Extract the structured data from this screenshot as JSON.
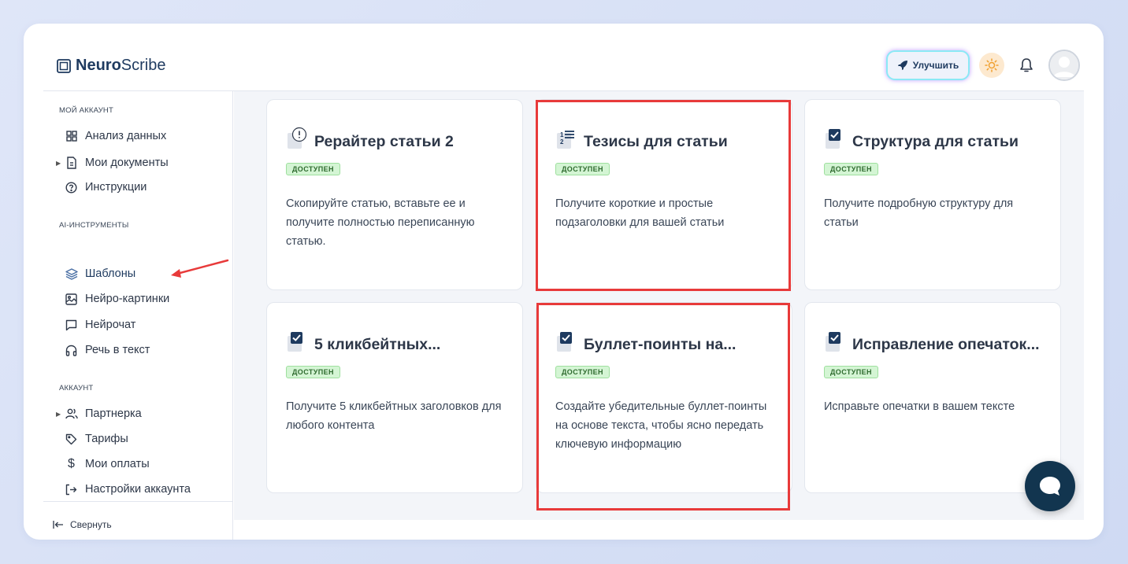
{
  "app": {
    "logo_bold": "Neuro",
    "logo_rest": "Scribe"
  },
  "header": {
    "upgrade_label": "Улучшить"
  },
  "sidebar": {
    "sections": [
      {
        "title": "МОЙ АККАУНТ",
        "items": [
          {
            "label": "Анализ данных",
            "icon": "grid-icon"
          },
          {
            "label": "Мои документы",
            "icon": "document-icon",
            "expandable": true
          },
          {
            "label": "Инструкции",
            "icon": "help-circle-icon"
          }
        ]
      },
      {
        "title": "AI-ИНСТРУМЕНТЫ",
        "items": [
          {
            "label": "Шаблоны",
            "icon": "layers-icon",
            "active": true
          },
          {
            "label": "Нейро-картинки",
            "icon": "image-icon"
          },
          {
            "label": "Нейрочат",
            "icon": "chat-icon"
          },
          {
            "label": "Речь в текст",
            "icon": "headphones-icon"
          }
        ]
      },
      {
        "title": "АККАУНТ",
        "items": [
          {
            "label": "Партнерка",
            "icon": "users-icon",
            "expandable": true
          },
          {
            "label": "Тарифы",
            "icon": "tag-icon"
          },
          {
            "label": "Мои оплаты",
            "icon": "dollar-icon"
          },
          {
            "label": "Настройки аккаунта",
            "icon": "logout-icon"
          }
        ]
      }
    ],
    "collapse_label": "Свернуть"
  },
  "cards": [
    {
      "title": "Рерайтер статьи 2",
      "badge": "ДОСТУПЕН",
      "desc": "Скопируйте статью, вставьте ее и получите полностью переписанную статью.",
      "icon": "alert-icon"
    },
    {
      "title": "Тезисы для статьи",
      "badge": "ДОСТУПЕН",
      "desc": "Получите короткие и простые подзаголовки для вашей статьи",
      "icon": "numbered-list-icon"
    },
    {
      "title": "Структура для статьи",
      "badge": "ДОСТУПЕН",
      "desc": "Получите подробную структуру для статьи",
      "icon": "checkbox-icon"
    },
    {
      "title": "5 кликбейтных...",
      "badge": "ДОСТУПЕН",
      "desc": "Получите 5 кликбейтных заголовков для любого контента",
      "icon": "checkbox-icon"
    },
    {
      "title": "Буллет-поинты на...",
      "badge": "ДОСТУПЕН",
      "desc": "Создайте убедительные буллет-поинты на основе текста, чтобы ясно передать ключевую информацию",
      "icon": "checkbox-icon"
    },
    {
      "title": "Исправление опечаток...",
      "badge": "ДОСТУПЕН",
      "desc": "Исправьте опечатки в вашем тексте",
      "icon": "checkbox-icon"
    }
  ],
  "colors": {
    "brand": "#1e3a5f",
    "highlight": "#e83a3a",
    "badge_bg": "#d4f5d4",
    "chat_fab": "#12354f"
  }
}
